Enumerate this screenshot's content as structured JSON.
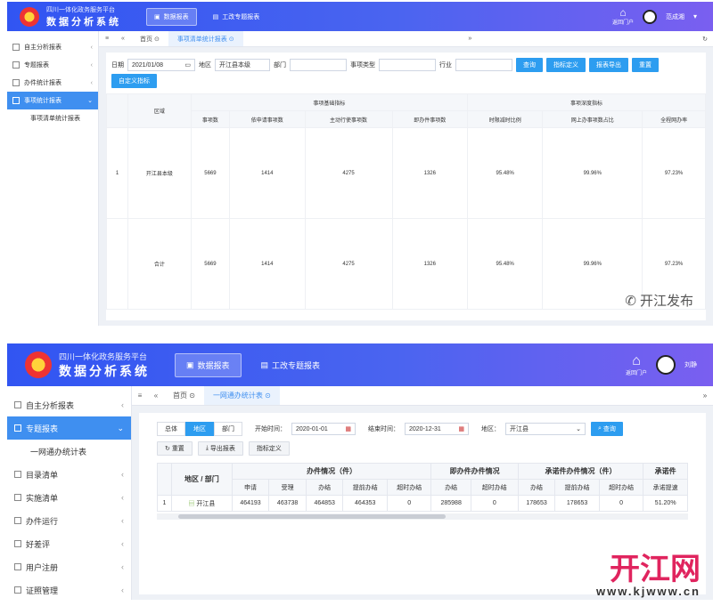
{
  "screens": [
    {
      "header": {
        "platform": "四川一体化政务服务平台",
        "system": "数据分析系统",
        "nav": [
          {
            "label": "数据报表",
            "active": true
          },
          {
            "label": "工改专题报表",
            "active": false
          }
        ],
        "home_label": "返回门户",
        "user": "范成湘"
      },
      "sidebar": [
        {
          "label": "自主分析报表",
          "active": false,
          "sub": false
        },
        {
          "label": "专题报表",
          "active": false,
          "sub": false
        },
        {
          "label": "办件统计报表",
          "active": false,
          "sub": false
        },
        {
          "label": "事项统计报表",
          "active": true,
          "sub": false
        },
        {
          "label": "事项清单统计报表",
          "active": false,
          "sub": true
        }
      ],
      "tabs": {
        "home": "首页",
        "current": "事项清单统计报表"
      },
      "filters": {
        "date_label": "日期",
        "date_value": "2021/01/08",
        "region_label": "地区",
        "region_value": "开江县本级",
        "dept_label": "部门",
        "type_label": "事项类型",
        "industry_label": "行业"
      },
      "buttons": [
        "查询",
        "指标定义",
        "报表导出",
        "重置",
        "自定义指标"
      ],
      "table": {
        "group1": "事项基础指标",
        "group2": "事项深度指标",
        "headers": [
          "区域",
          "事项数",
          "依申请事项数",
          "主动行使事项数",
          "即办件事项数",
          "时限减时比例",
          "网上办事项数占比",
          "全程网办率"
        ],
        "rows": [
          {
            "no": "1",
            "region": "开江县本级",
            "v": [
              "5669",
              "1414",
              "4275",
              "1326",
              "95.48%",
              "99.96%",
              "97.23%"
            ]
          },
          {
            "no": "",
            "region": "合计",
            "v": [
              "5669",
              "1414",
              "4275",
              "1326",
              "95.48%",
              "99.96%",
              "97.23%"
            ]
          }
        ]
      },
      "watermark": "开江发布"
    },
    {
      "header": {
        "platform": "四川一体化政务服务平台",
        "system": "数据分析系统",
        "nav": [
          {
            "label": "数据报表",
            "active": true
          },
          {
            "label": "工改专题报表",
            "active": false
          }
        ],
        "home_label": "返回门户",
        "user": "刘静"
      },
      "sidebar": [
        {
          "label": "自主分析报表",
          "active": false,
          "sub": false
        },
        {
          "label": "专题报表",
          "active": true,
          "sub": false
        },
        {
          "label": "一网通办统计表",
          "active": false,
          "sub": true
        },
        {
          "label": "目录清单",
          "active": false,
          "sub": false
        },
        {
          "label": "实施清单",
          "active": false,
          "sub": false
        },
        {
          "label": "办件运行",
          "active": false,
          "sub": false
        },
        {
          "label": "好差评",
          "active": false,
          "sub": false
        },
        {
          "label": "用户注册",
          "active": false,
          "sub": false
        },
        {
          "label": "证照管理",
          "active": false,
          "sub": false
        }
      ],
      "tabs": {
        "home": "首页",
        "current": "一网通办统计表"
      },
      "filters": {
        "seg": [
          "总体",
          "地区",
          "部门"
        ],
        "seg_active": 1,
        "start_label": "开始时间：",
        "start_value": "2020-01-01",
        "end_label": "结束时间：",
        "end_value": "2020-12-31",
        "region_label": "地区：",
        "region_value": "开江县"
      },
      "buttons": {
        "search": "查询",
        "reset": "重置",
        "export": "导出报表",
        "indicator": "指标定义"
      },
      "table": {
        "col_region": "地区 / 部门",
        "groups": [
          "办件情况（件）",
          "即办件办件情况",
          "承诺件办件情况（件）",
          "承诺件"
        ],
        "sub": [
          "申请",
          "受理",
          "办结",
          "提前办结",
          "超时办结",
          "办结",
          "超时办结",
          "办结",
          "提前办结",
          "超时办结",
          "承诺提速"
        ],
        "row": {
          "no": "1",
          "region": "开江县",
          "v": [
            "464193",
            "463738",
            "464853",
            "464353",
            "0",
            "285988",
            "0",
            "178653",
            "178653",
            "0",
            "51.20%"
          ]
        }
      },
      "watermark": "开江网",
      "watermark_url": "www.kjwww.cn"
    }
  ]
}
